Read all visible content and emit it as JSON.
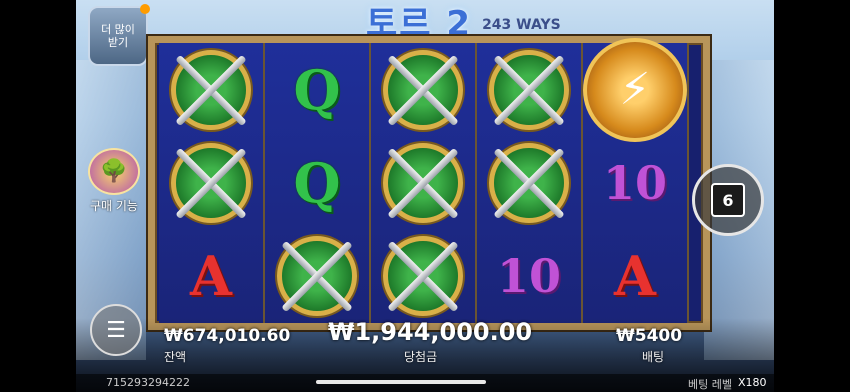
{
  "game": {
    "logo": "토르 2",
    "ways": "243 WAYS"
  },
  "left_button": {
    "line1": "더 많이",
    "line2": "받기"
  },
  "buy_feature": {
    "label": "구매 기능"
  },
  "auto_button": {
    "value": "6"
  },
  "reels": [
    [
      "shield",
      "shield",
      "A"
    ],
    [
      "Q",
      "Q",
      "shield"
    ],
    [
      "shield",
      "shield",
      "shield"
    ],
    [
      "shield",
      "shield",
      "10"
    ],
    [
      "thor",
      "10",
      "A"
    ]
  ],
  "balance": {
    "value": "₩674,010.60",
    "label": "잔액"
  },
  "win": {
    "value": "₩1,944,000.00",
    "label": "당첨금"
  },
  "bet": {
    "value": "₩5400",
    "label": "배팅"
  },
  "footer": {
    "id": "715293294222",
    "bet_level_label": "베팅 레벨",
    "bet_level_value": "X180"
  }
}
